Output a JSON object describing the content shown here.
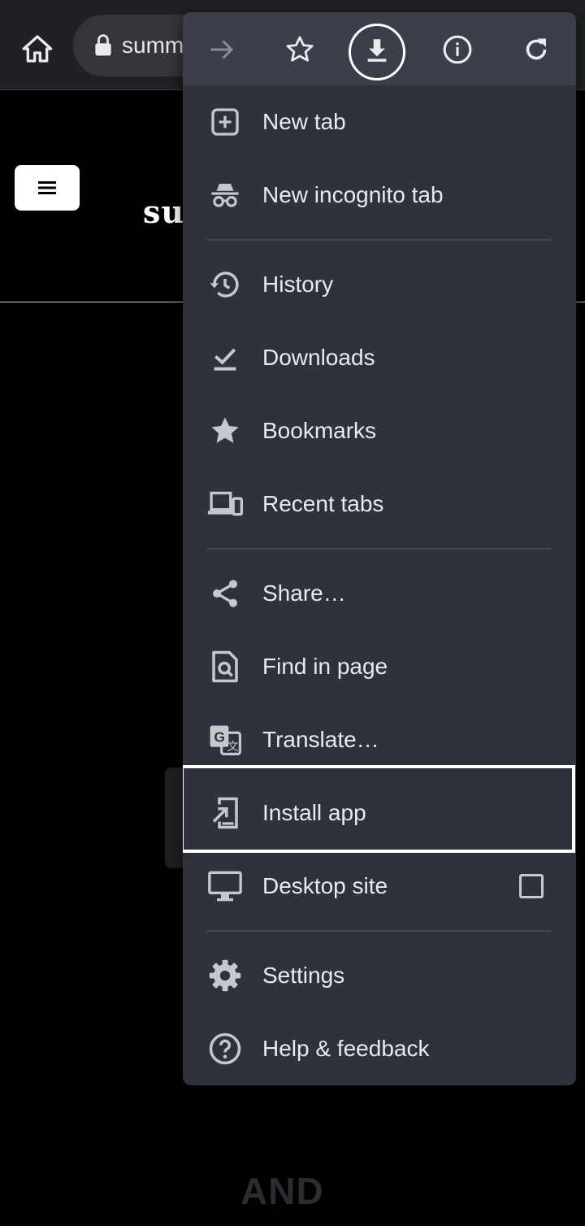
{
  "browser": {
    "url_text": "summ",
    "site_title": "su",
    "bottom_text": "AND"
  },
  "menu": {
    "top_icons": [
      "forward-icon",
      "star-icon",
      "download-icon",
      "info-icon",
      "refresh-icon"
    ],
    "items": [
      {
        "label": "New tab",
        "icon": "new-tab-icon"
      },
      {
        "label": "New incognito tab",
        "icon": "incognito-icon"
      },
      {
        "label": "History",
        "icon": "history-icon"
      },
      {
        "label": "Downloads",
        "icon": "downloads-icon"
      },
      {
        "label": "Bookmarks",
        "icon": "bookmark-star-icon"
      },
      {
        "label": "Recent tabs",
        "icon": "devices-icon"
      },
      {
        "label": "Share…",
        "icon": "share-icon"
      },
      {
        "label": "Find in page",
        "icon": "find-in-page-icon"
      },
      {
        "label": "Translate…",
        "icon": "translate-icon"
      },
      {
        "label": "Install app",
        "icon": "install-app-icon"
      },
      {
        "label": "Desktop site",
        "icon": "desktop-icon",
        "checked": false
      },
      {
        "label": "Settings",
        "icon": "settings-gear-icon"
      },
      {
        "label": "Help & feedback",
        "icon": "help-icon"
      }
    ]
  },
  "colors": {
    "menu_bg": "#2f323b",
    "menu_top_bg": "#3b3f4a",
    "highlight": "#ffffff"
  }
}
